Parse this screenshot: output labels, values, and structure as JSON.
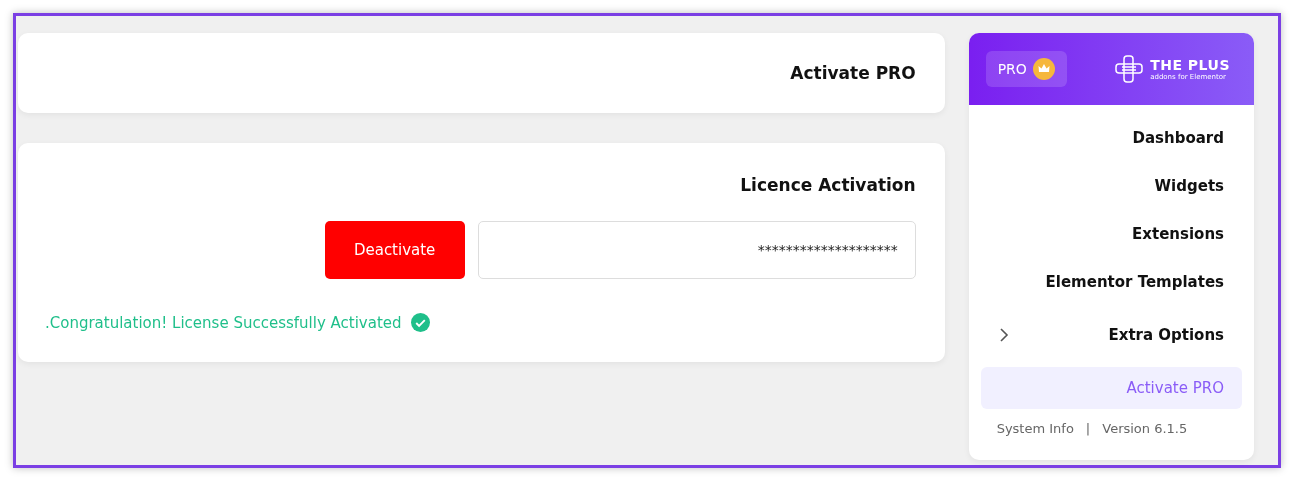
{
  "page_header": {
    "title": "Activate PRO"
  },
  "licence_card": {
    "title": "Licence Activation",
    "button": "Deactivate",
    "key_field": {
      "value": "********************"
    },
    "message": ".Congratulation! License Successfully Activated"
  },
  "sidebar": {
    "badge": "PRO",
    "logo": {
      "name": "THE PLUS",
      "tagline": "addons for Elementor"
    },
    "items": [
      {
        "label": "Dashboard",
        "selected": false
      },
      {
        "label": "Widgets",
        "selected": false
      },
      {
        "label": "Extensions",
        "selected": false
      },
      {
        "label": "Elementor Templates",
        "selected": false
      },
      {
        "label": "Extra Options",
        "selected": false,
        "expanded": false
      },
      {
        "label": "Activate PRO",
        "selected": true
      }
    ],
    "footer": {
      "link": "System Info",
      "separator": "|",
      "version": "Version 6.1.5"
    }
  }
}
